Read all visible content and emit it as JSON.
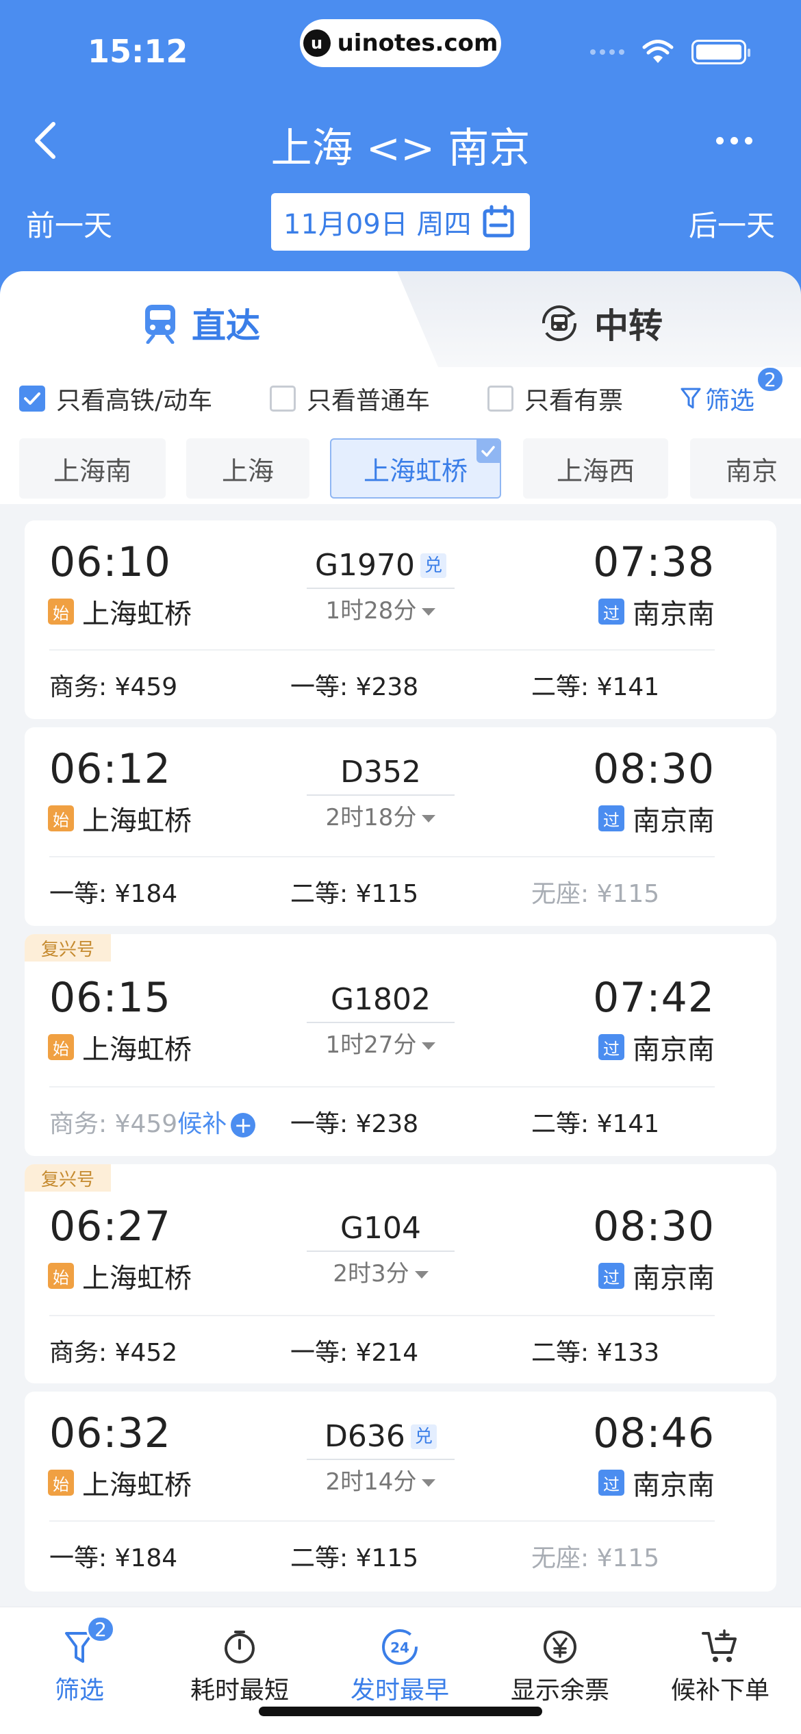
{
  "status": {
    "time": "15:12",
    "url": "uinotes.com",
    "logo_letter": "u"
  },
  "header": {
    "title": "上海 <> 南京",
    "prev_day": "前一天",
    "next_day": "后一天",
    "date": "11月09日 周四",
    "colors": {
      "primary": "#4b8df0",
      "accent_text": "#3a7ee8"
    }
  },
  "tabs": {
    "direct": "直达",
    "transfer": "中转"
  },
  "filters": {
    "high_speed": "只看高铁/动车",
    "normal": "只看普通车",
    "available": "只看有票",
    "filter_label": "筛选",
    "filter_badge": "2"
  },
  "stations": [
    "上海南",
    "上海",
    "上海虹桥",
    "上海西",
    "南京"
  ],
  "trains": [
    {
      "tag": "",
      "dep": "06:10",
      "dep_station": "上海虹桥",
      "dep_badge": "始",
      "no": "G1970",
      "exchange": "兑",
      "duration": "1时28分",
      "arr": "07:38",
      "arr_station": "南京南",
      "arr_badge": "过",
      "prices": [
        "商务: ¥459",
        "一等: ¥238",
        "二等: ¥141"
      ]
    },
    {
      "tag": "",
      "dep": "06:12",
      "dep_station": "上海虹桥",
      "dep_badge": "始",
      "no": "D352",
      "exchange": "",
      "duration": "2时18分",
      "arr": "08:30",
      "arr_station": "南京南",
      "arr_badge": "过",
      "prices": [
        "一等: ¥184",
        "二等: ¥115",
        "无座: ¥115"
      ]
    },
    {
      "tag": "复兴号",
      "dep": "06:15",
      "dep_station": "上海虹桥",
      "dep_badge": "始",
      "no": "G1802",
      "exchange": "",
      "duration": "1时27分",
      "arr": "07:42",
      "arr_station": "南京南",
      "arr_badge": "过",
      "prices": [
        "商务: ¥459",
        "一等: ¥238",
        "二等: ¥141"
      ],
      "wait_label": "候补"
    },
    {
      "tag": "复兴号",
      "dep": "06:27",
      "dep_station": "上海虹桥",
      "dep_badge": "始",
      "no": "G104",
      "exchange": "",
      "duration": "2时3分",
      "arr": "08:30",
      "arr_station": "南京南",
      "arr_badge": "过",
      "prices": [
        "商务: ¥452",
        "一等: ¥214",
        "二等: ¥133"
      ]
    },
    {
      "tag": "",
      "dep": "06:32",
      "dep_station": "上海虹桥",
      "dep_badge": "始",
      "no": "D636",
      "exchange": "兑",
      "duration": "2时14分",
      "arr": "08:46",
      "arr_station": "南京南",
      "arr_badge": "过",
      "prices": [
        "一等: ¥184",
        "二等: ¥115",
        "无座: ¥115"
      ]
    }
  ],
  "bottom_nav": {
    "filter": "筛选",
    "filter_badge": "2",
    "shortest": "耗时最短",
    "earliest": "发时最早",
    "earliest_icon_text": "24",
    "show_remaining": "显示余票",
    "waitlist": "候补下单"
  }
}
